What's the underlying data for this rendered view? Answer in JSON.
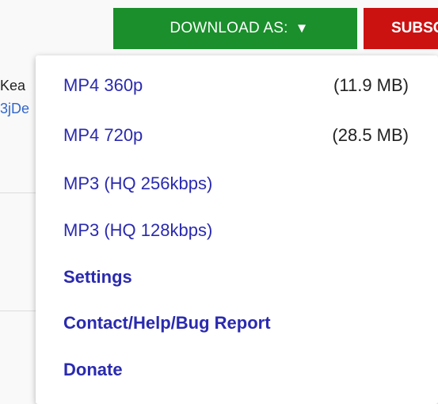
{
  "toolbar": {
    "download_label": "DOWNLOAD AS:",
    "download_arrow": "▼",
    "subscribe_label": "SUBSCRIBE"
  },
  "background": {
    "text_line_1": "Kea",
    "text_line_2": "3jDe"
  },
  "dropdown": {
    "items": [
      {
        "label": "MP4 360p",
        "size": "(11.9 MB)"
      },
      {
        "label": "MP4 720p",
        "size": "(28.5 MB)"
      },
      {
        "label": "MP3 (HQ 256kbps)"
      },
      {
        "label": "MP3 (HQ 128kbps)"
      },
      {
        "label": "Settings"
      },
      {
        "label": "Contact/Help/Bug Report"
      },
      {
        "label": "Donate"
      }
    ]
  },
  "colors": {
    "download_bg": "#1a8f2c",
    "subscribe_bg": "#cc1111",
    "link": "#2a2ab0"
  }
}
